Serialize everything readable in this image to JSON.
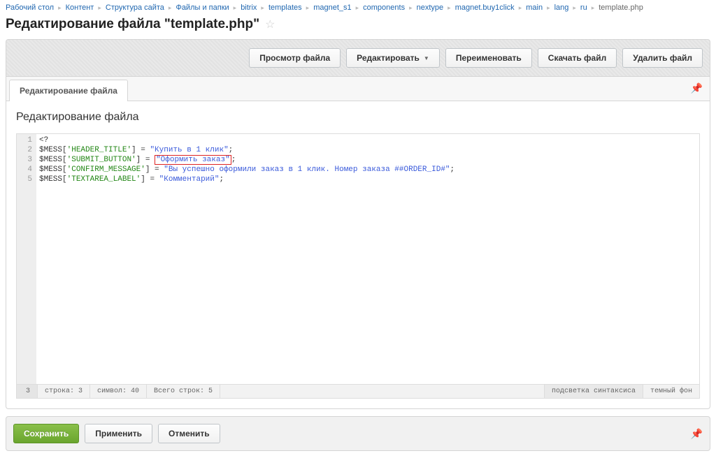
{
  "breadcrumbs": [
    "Рабочий стол",
    "Контент",
    "Структура сайта",
    "Файлы и папки",
    "bitrix",
    "templates",
    "magnet_s1",
    "components",
    "nextype",
    "magnet.buy1click",
    "main",
    "lang",
    "ru",
    "template.php"
  ],
  "page_title": "Редактирование файла \"template.php\"",
  "toolbar": {
    "view": "Просмотр файла",
    "edit": "Редактировать",
    "rename": "Переименовать",
    "download": "Скачать файл",
    "delete": "Удалить файл"
  },
  "tabs": {
    "edit_file": "Редактирование файла"
  },
  "panel_heading": "Редактирование файла",
  "code_lines": [
    {
      "n": 1,
      "raw": "<?"
    },
    {
      "n": 2,
      "key": "HEADER_TITLE",
      "val": "Купить в 1 клик"
    },
    {
      "n": 3,
      "key": "SUBMIT_BUTTON",
      "val": "Оформить заказ",
      "highlight": true
    },
    {
      "n": 4,
      "key": "CONFIRM_MESSAGE",
      "val": "Вы успешно оформили заказ в 1 клик. Номер заказа ##ORDER_ID#"
    },
    {
      "n": 5,
      "key": "TEXTAREA_LABEL",
      "val": "Комментарий"
    }
  ],
  "status": {
    "current_line_num": "3",
    "line_label": "строка: 3",
    "col_label": "символ: 40",
    "total_label": "Всего строк: 5",
    "syntax": "подсветка синтаксиса",
    "dark": "темный фон"
  },
  "bottom": {
    "save": "Сохранить",
    "apply": "Применить",
    "cancel": "Отменить"
  }
}
